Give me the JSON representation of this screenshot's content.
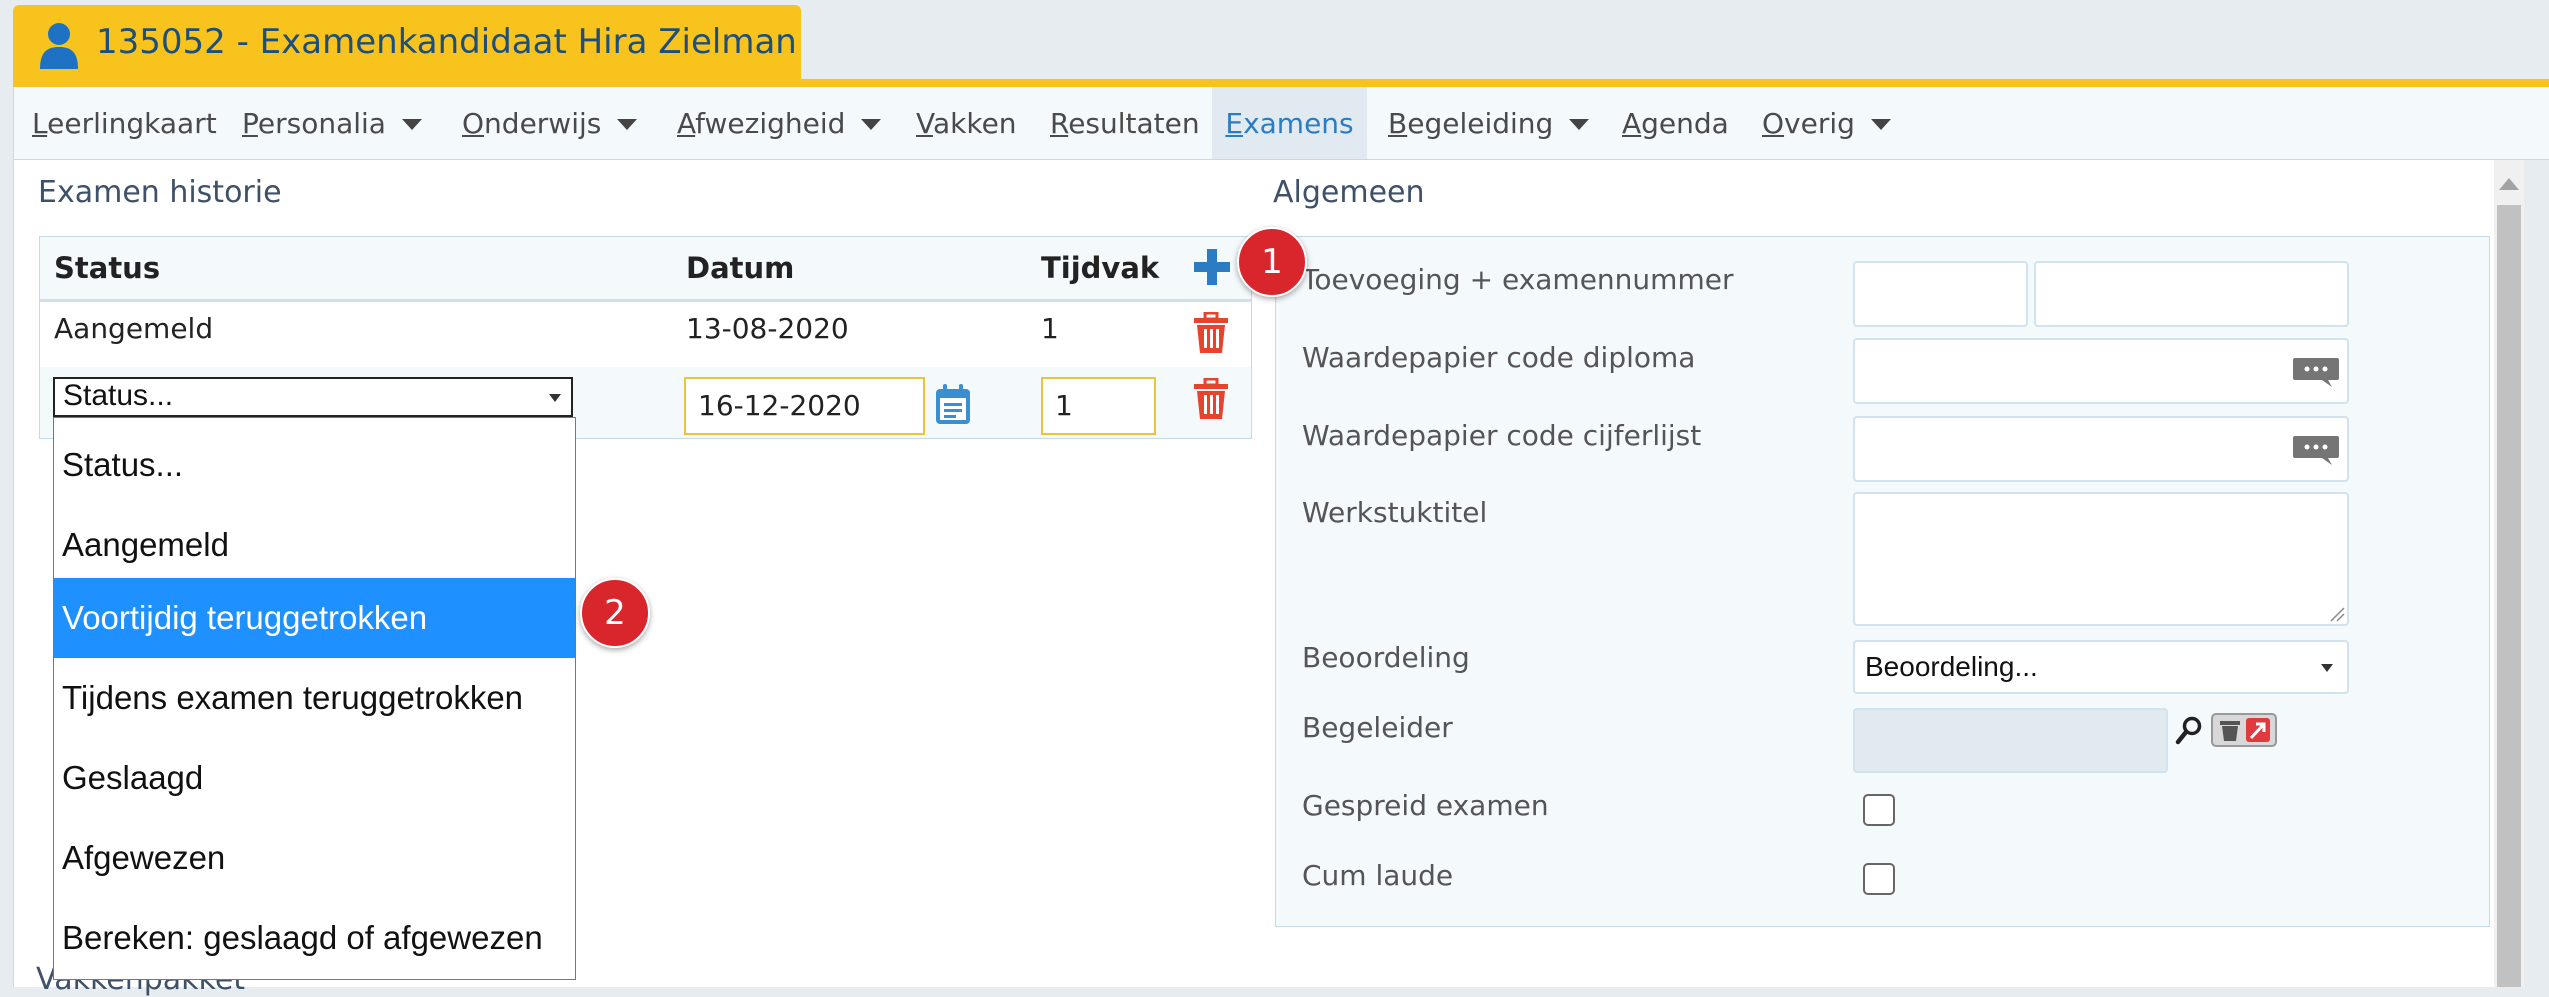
{
  "header": {
    "title": "135052 - Examenkandidaat Hira Zielman",
    "user_icon": "user-icon"
  },
  "colors": {
    "header_gold": "#f8c31c",
    "title_blue": "#1d4f7c",
    "accent_blue": "#2b7cc3",
    "selected_blue": "#1e90ff",
    "delete_red": "#e8432d",
    "badge_red": "#d9262c"
  },
  "nav": {
    "items": [
      {
        "label": "Leerlingkaart",
        "has_dropdown": false
      },
      {
        "label": "Personalia",
        "has_dropdown": true
      },
      {
        "label": "Onderwijs",
        "has_dropdown": true
      },
      {
        "label": "Afwezigheid",
        "has_dropdown": true
      },
      {
        "label": "Vakken",
        "has_dropdown": false
      },
      {
        "label": "Resultaten",
        "has_dropdown": false
      },
      {
        "label": "Examens",
        "has_dropdown": false,
        "active": true
      },
      {
        "label": "Begeleiding",
        "has_dropdown": true
      },
      {
        "label": "Agenda",
        "has_dropdown": false
      },
      {
        "label": "Overig",
        "has_dropdown": true
      }
    ]
  },
  "historie": {
    "title": "Examen historie",
    "columns": [
      "Status",
      "Datum",
      "Tijdvak"
    ],
    "rows": [
      {
        "status": "Aangemeld",
        "datum": "13-08-2020",
        "tijdvak": "1"
      }
    ],
    "new_row": {
      "status_value": "Status...",
      "datum_value": "16-12-2020",
      "tijdvak_value": "1"
    },
    "status_options": [
      "Status...",
      "Aangemeld",
      "Voortijdig teruggetrokken",
      "Tijdens examen teruggetrokken",
      "Geslaagd",
      "Afgewezen",
      "Bereken: geslaagd of afgewezen"
    ],
    "selected_option": "Voortijdig teruggetrokken",
    "below_text": "Vakkenpakket"
  },
  "callouts": [
    "1",
    "2"
  ],
  "algemeen": {
    "title": "Algemeen",
    "fields": {
      "toevoeging": "Toevoeging + examennummer",
      "code_diploma": "Waardepapier code diploma",
      "code_cijferlijst": "Waardepapier code cijferlijst",
      "werkstuktitel": "Werkstuktitel",
      "beoordeling": "Beoordeling",
      "begeleider": "Begeleider",
      "gespreid": "Gespreid examen",
      "cum_laude": "Cum laude"
    },
    "beoordeling_value": "Beoordeling..."
  }
}
